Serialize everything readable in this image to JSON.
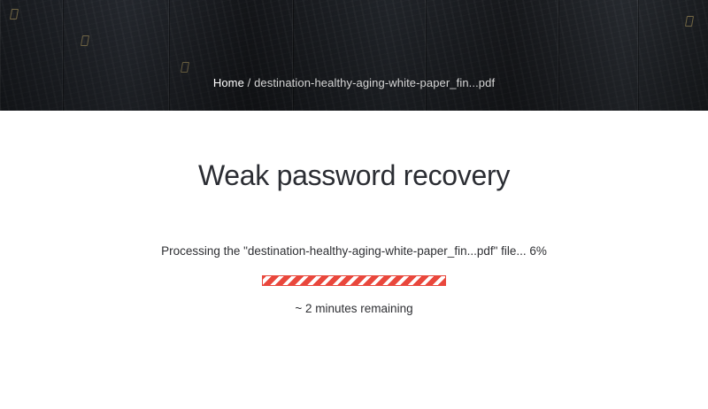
{
  "breadcrumb": {
    "home_label": "Home",
    "separator": "/",
    "current": "destination-healthy-aging-white-paper_fin...pdf"
  },
  "page": {
    "title": "Weak password recovery"
  },
  "processing": {
    "status_text": "Processing the \"destination-healthy-aging-white-paper_fin...pdf\" file... 6%",
    "progress_percent": 6,
    "progress_bar_color": "#e9473c",
    "remaining_text": "~ 2 minutes remaining"
  }
}
